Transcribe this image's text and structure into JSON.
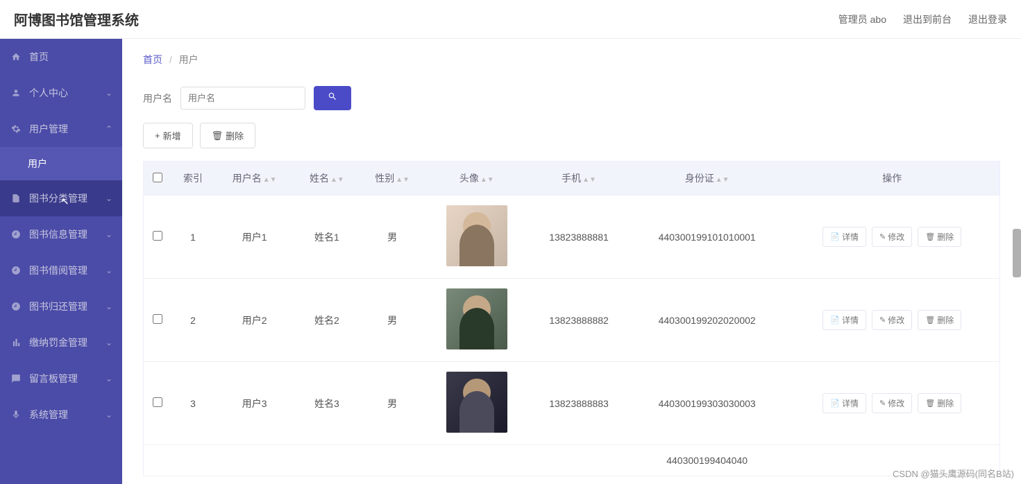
{
  "app_title": "阿博图书馆管理系统",
  "header_links": {
    "admin": "管理员 abo",
    "front": "退出到前台",
    "logout": "退出登录"
  },
  "sidebar": [
    {
      "icon": "home",
      "label": "首页",
      "chev": false
    },
    {
      "icon": "user",
      "label": "个人中心",
      "chev": true
    },
    {
      "icon": "gear",
      "label": "用户管理",
      "chev": true,
      "expanded": true,
      "sub": [
        "用户"
      ]
    },
    {
      "icon": "doc",
      "label": "图书分类管理",
      "chev": true,
      "active": true
    },
    {
      "icon": "clock",
      "label": "图书信息管理",
      "chev": true
    },
    {
      "icon": "clock",
      "label": "图书借阅管理",
      "chev": true
    },
    {
      "icon": "clock",
      "label": "图书归还管理",
      "chev": true
    },
    {
      "icon": "bar",
      "label": "缴纳罚金管理",
      "chev": true
    },
    {
      "icon": "chat",
      "label": "留言板管理",
      "chev": true
    },
    {
      "icon": "mic",
      "label": "系统管理",
      "chev": true
    }
  ],
  "breadcrumb": {
    "home": "首页",
    "current": "用户"
  },
  "search": {
    "label": "用户名",
    "placeholder": "用户名"
  },
  "actions": {
    "add": "新增",
    "delete": "删除"
  },
  "table": {
    "headers": [
      "索引",
      "用户名",
      "姓名",
      "性别",
      "头像",
      "手机",
      "身份证",
      "操作"
    ],
    "row_actions": {
      "detail": "详情",
      "edit": "修改",
      "delete": "删除"
    },
    "rows": [
      {
        "idx": "1",
        "username": "用户1",
        "name": "姓名1",
        "gender": "男",
        "avatar": "a1",
        "phone": "13823888881",
        "idcard": "440300199101010001"
      },
      {
        "idx": "2",
        "username": "用户2",
        "name": "姓名2",
        "gender": "男",
        "avatar": "a2",
        "phone": "13823888882",
        "idcard": "440300199202020002"
      },
      {
        "idx": "3",
        "username": "用户3",
        "name": "姓名3",
        "gender": "男",
        "avatar": "a3",
        "phone": "13823888883",
        "idcard": "440300199303030003"
      }
    ],
    "partial_row": {
      "idcard": "440300199404040"
    }
  },
  "watermark": "CSDN @猫头鹰源码(同名B站)"
}
